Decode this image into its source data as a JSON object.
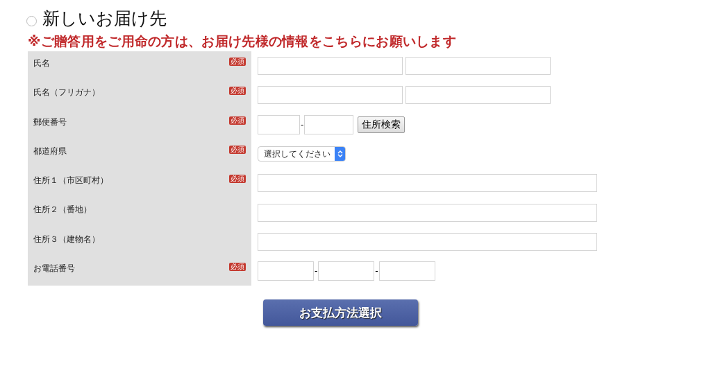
{
  "address_option": {
    "label": "新しいお届け先",
    "selected": false
  },
  "notice": "※ご贈答用をご用命の方は、お届け先様の情報をこちらにお願いします",
  "rows": [
    {
      "label": "氏名",
      "badge": "必須",
      "kind": "pair"
    },
    {
      "label": "氏名（フリガナ）",
      "badge": "必須",
      "kind": "pair"
    },
    {
      "label": "郵便番号",
      "badge": "必須",
      "kind": "zip",
      "separator": "-",
      "button": "住所検索"
    },
    {
      "label": "都道府県",
      "badge": "必須",
      "kind": "select",
      "value": "選択してください"
    },
    {
      "label": "住所１（市区町村）",
      "badge": "必須",
      "kind": "single"
    },
    {
      "label": "住所２（番地）",
      "kind": "single"
    },
    {
      "label": "住所３（建物名）",
      "kind": "single"
    },
    {
      "label": "お電話番号",
      "badge": "必須",
      "kind": "tel",
      "separator": "-"
    }
  ],
  "submit_button": "お支払方法選択"
}
